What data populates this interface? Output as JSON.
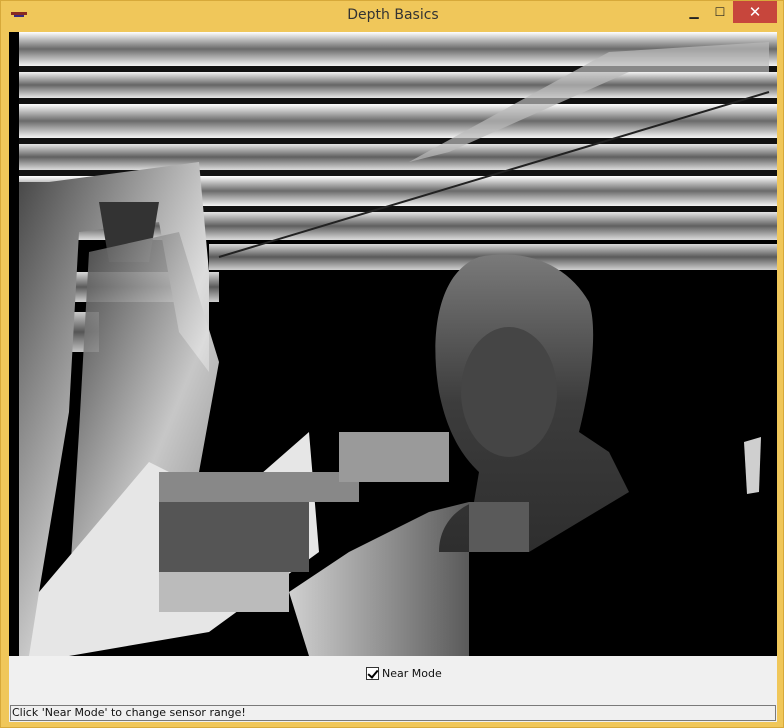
{
  "window": {
    "title": "Depth Basics",
    "minimize_icon": "minimize-icon",
    "maximize_icon": "maximize-icon",
    "close_icon": "close-icon",
    "accent": "#f0c75a",
    "close_color": "#c7463c"
  },
  "viewer": {
    "content": "depth-frame-image"
  },
  "controls": {
    "near_mode_label": "Near Mode",
    "near_mode_checked": true
  },
  "status": {
    "text": "Click 'Near Mode' to change sensor range!"
  }
}
